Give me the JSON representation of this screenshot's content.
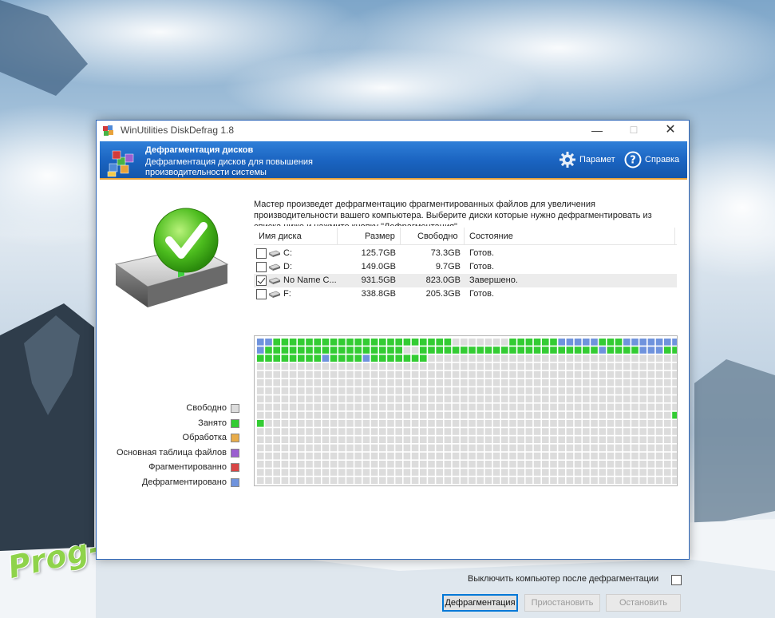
{
  "watermark": "Prog-Top.net",
  "window": {
    "title": "WinUtilities DiskDefrag 1.8",
    "controls": {
      "minimize": "—",
      "maximize": "☐",
      "close": "✕"
    }
  },
  "banner": {
    "title": "Дефрагментация дисков",
    "subtitle": "Дефрагментация дисков для повышения производительности системы",
    "options_label": "Парамет",
    "help_label": "Справка",
    "options_icon": "gear-icon",
    "help_icon": "question-icon"
  },
  "intro_text": "Мастер произведет дефрагментацию фрагментированных файлов для увеличения производительности вашего компьютера. Выберите диски которые нужно дефрагментировать из списка ниже и нажмите кнопку \"Дефрагментация\"",
  "drives": {
    "columns": {
      "name": "Имя диска",
      "size": "Размер",
      "free": "Свободно",
      "state": "Состояние"
    },
    "rows": [
      {
        "checked": false,
        "name": "C:",
        "size": "125.7GB",
        "free": "73.3GB",
        "state": "Готов."
      },
      {
        "checked": false,
        "name": "D:",
        "size": "149.0GB",
        "free": "9.7GB",
        "state": "Готов."
      },
      {
        "checked": true,
        "name": "No Name C...",
        "size": "931.5GB",
        "free": "823.0GB",
        "state": "Завершено."
      },
      {
        "checked": false,
        "name": "F:",
        "size": "338.8GB",
        "free": "205.3GB",
        "state": "Готов."
      }
    ]
  },
  "legend": [
    {
      "label": "Свободно",
      "color": "#dcdcdc"
    },
    {
      "label": "Занято",
      "color": "#33cc33"
    },
    {
      "label": "Обработка",
      "color": "#e8ac4a"
    },
    {
      "label": "Основная таблица файлов",
      "color": "#9b5fd0"
    },
    {
      "label": "Фрагментированно",
      "color": "#d84545"
    },
    {
      "label": "Дефрагментировано",
      "color": "#6f93dd"
    }
  ],
  "shutdown_label": "Выключить компьютер после дефрагментации",
  "shutdown_checked": false,
  "buttons": {
    "defrag": "Дефрагментация",
    "pause": "Приостановить",
    "stop": "Остановить"
  }
}
